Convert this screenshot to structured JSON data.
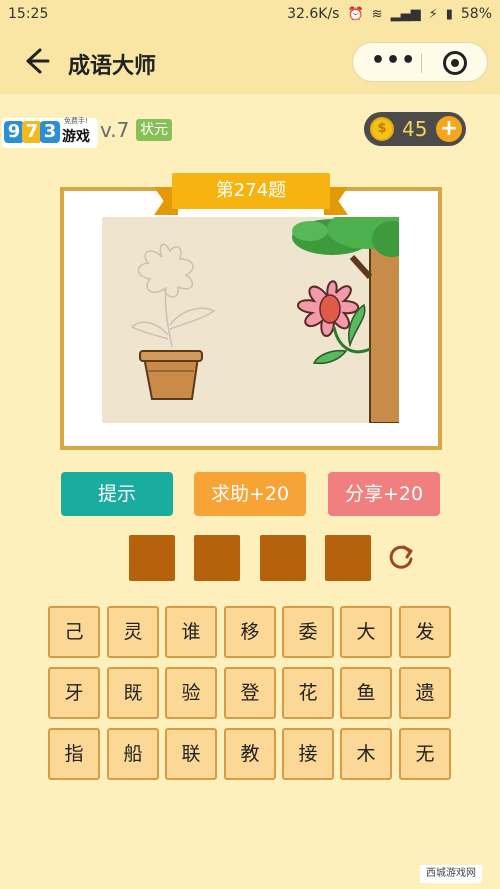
{
  "status_bar": {
    "time": "15:25",
    "speed": "32.6K/s",
    "battery": "58%"
  },
  "header": {
    "title": "成语大师",
    "back_icon": "back-arrow-icon",
    "more_icon": "more-dots-icon",
    "close_icon": "target-circle-icon"
  },
  "profile": {
    "logo_digits": [
      "9",
      "7",
      "3"
    ],
    "logo_text": "游戏",
    "logo_small": "免费手!",
    "level": "v.7",
    "rank": "状元"
  },
  "coins": {
    "count": "45",
    "add_label": "+",
    "coin_symbol": "$"
  },
  "puzzle": {
    "title": "第274题"
  },
  "buttons": {
    "hint": "提示",
    "help": "求助+20",
    "share": "分享+20"
  },
  "answer_slots": [
    "",
    "",
    "",
    ""
  ],
  "characters": [
    [
      "己",
      "灵",
      "谁",
      "移",
      "委",
      "大",
      "发"
    ],
    [
      "牙",
      "既",
      "验",
      "登",
      "花",
      "鱼",
      "遗"
    ],
    [
      "指",
      "船",
      "联",
      "教",
      "接",
      "木",
      "无"
    ]
  ],
  "watermark": "西城游戏网",
  "colors": {
    "background": "#fdf0bd",
    "slot": "#b6610b",
    "hint": "#1aac9e",
    "help": "#f8a336",
    "share": "#f07f7f",
    "frame": "#d9a646"
  }
}
